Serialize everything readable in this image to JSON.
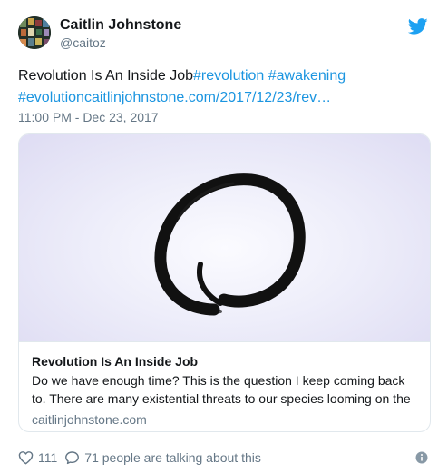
{
  "author": {
    "name": "Caitlin Johnstone",
    "handle": "@caitoz"
  },
  "icons": {
    "brand": "twitter-bird-icon",
    "like": "heart-icon",
    "reply": "speech-bubble-icon",
    "info": "info-icon"
  },
  "colors": {
    "link": "#1b95e0",
    "secondary": "#657786",
    "twitter_blue": "#1da1f2"
  },
  "tweet": {
    "text_plain": "Revolution Is An Inside Job",
    "hashtag_1": "#revolution",
    "hashtag_2": "#awakening",
    "hashtag_3": "#evolution",
    "link_text": "caitlinjohnstone.com/2017/12/23/rev…",
    "timestamp": "11:00 PM - Dec 23, 2017"
  },
  "card": {
    "title": "Revolution Is An Inside Job",
    "description": "Do we have enough time? This is the question I keep coming back to. There are many existential threats to our species looming on the",
    "domain": "caitlinjohnstone.com"
  },
  "actions": {
    "likes": "111",
    "conversation": "71 people are talking about this"
  }
}
